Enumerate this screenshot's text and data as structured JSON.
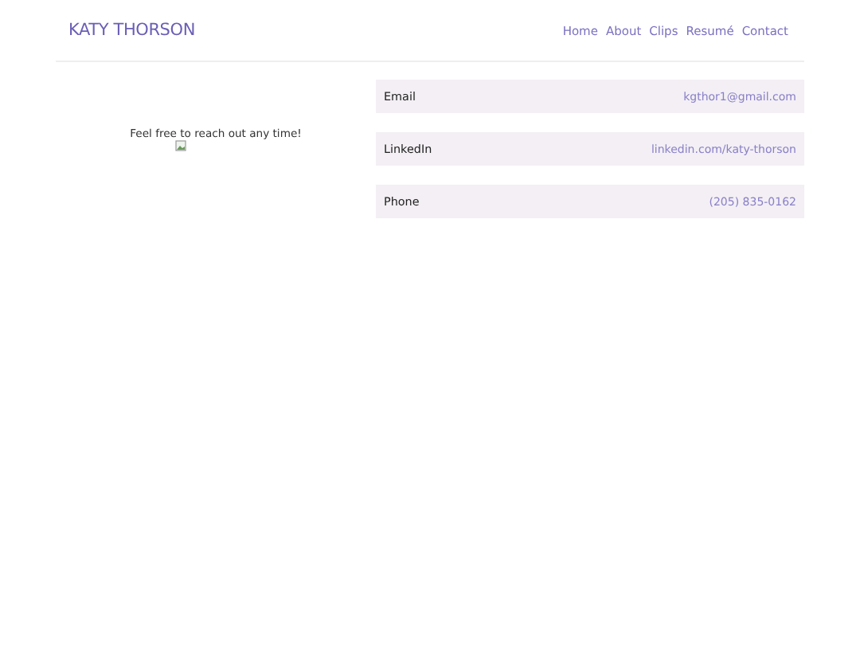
{
  "header": {
    "logo": "KATY THORSON",
    "nav": [
      "Home",
      "About",
      "Clips",
      "Resumé",
      "Contact"
    ]
  },
  "intro": {
    "text": "Feel free to reach out any time!"
  },
  "contacts": [
    {
      "label": "Email",
      "value": "kgthor1@gmail.com"
    },
    {
      "label": "LinkedIn",
      "value": "linkedin.com/katy-thorson"
    },
    {
      "label": "Phone",
      "value": "(205) 835-0162"
    }
  ]
}
